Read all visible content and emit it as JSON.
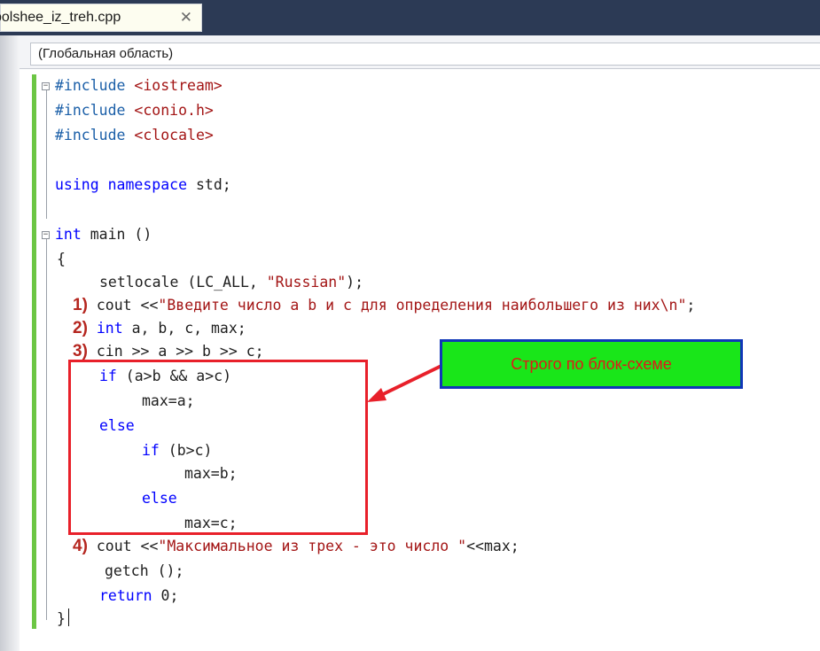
{
  "tab": {
    "filename": "bolshee_iz_treh.cpp",
    "close_glyph": "✕"
  },
  "scope": {
    "label": "(Глобальная область)"
  },
  "code": {
    "l1_pp": "#include ",
    "l1_inc": "<iostream>",
    "l2_pp": "#include ",
    "l2_inc": "<conio.h>",
    "l3_pp": "#include ",
    "l3_inc": "<clocale>",
    "l4_kw1": "using",
    "l4_kw2": "namespace",
    "l4_rest": " std;",
    "l5_kw": "int",
    "l5_rest": " main ()",
    "l6": "{",
    "l7_a": "setlocale (LC_ALL, ",
    "l7_str": "\"Russian\"",
    "l7_b": ");",
    "l8_num": "1)",
    "l8_a": " cout <<",
    "l8_str": "\"Введите число a b и c для определения наибольшего из них\\n\"",
    "l8_b": ";",
    "l9_num": "2)",
    "l9_kw": " int",
    "l9_rest": " a, b, c, max;",
    "l10_num": "3)",
    "l10_rest": " cin >> a >> b >> c;",
    "l11_kw": "if",
    "l11_rest": " (a>b && a>c)",
    "l12": "max=a;",
    "l13_kw": "else",
    "l14_kw": "if",
    "l14_rest": " (b>c)",
    "l15": "max=b;",
    "l16_kw": "else",
    "l17": "max=c;",
    "l18_num": "4)",
    "l18_a": " cout <<",
    "l18_str": "\"Максимальное из трех - это число \"",
    "l18_b": "<<max;",
    "l19": "getch ();",
    "l20_kw": "return",
    "l20_rest": " 0;",
    "l21": "}"
  },
  "callout": {
    "text": "Строго по блок-схеме"
  },
  "colors": {
    "keyword": "#0000ff",
    "string": "#a31515",
    "highlight_box": "#e8202a",
    "callout_bg": "#19e619",
    "callout_border": "#1036b8"
  }
}
